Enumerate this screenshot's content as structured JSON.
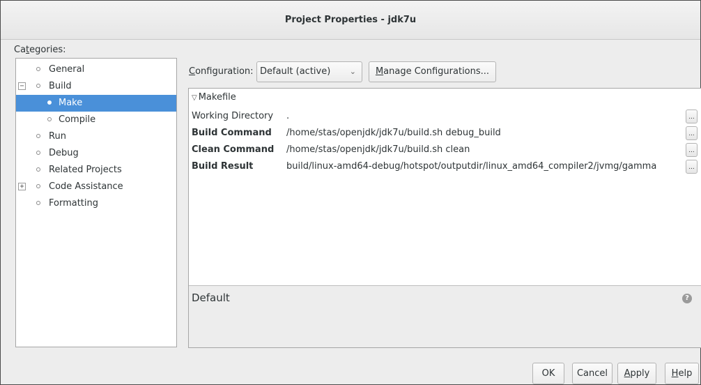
{
  "window": {
    "title": "Project Properties - jdk7u"
  },
  "categories": {
    "label_prefix": "Ca",
    "label_underline": "t",
    "label_suffix": "egories:",
    "items": [
      {
        "label": "General"
      },
      {
        "label": "Build",
        "expander": "−"
      },
      {
        "label": "Make",
        "selected": true
      },
      {
        "label": "Compile"
      },
      {
        "label": "Run"
      },
      {
        "label": "Debug"
      },
      {
        "label": "Related Projects"
      },
      {
        "label": "Code Assistance",
        "expander": "+"
      },
      {
        "label": "Formatting"
      }
    ]
  },
  "configuration": {
    "label_underline": "C",
    "label_rest": "onfiguration:",
    "selected_value": "Default (active)",
    "arrow": "⌄",
    "manage_underline": "M",
    "manage_rest": "anage Configurations..."
  },
  "makefile": {
    "section_label": "Makefile",
    "rows": [
      {
        "name": "Working Directory",
        "value": ".",
        "bold": false,
        "button": "..."
      },
      {
        "name": "Build Command",
        "value": "/home/stas/openjdk/jdk7u/build.sh debug_build",
        "bold": true,
        "button": "..."
      },
      {
        "name": "Clean Command",
        "value": "/home/stas/openjdk/jdk7u/build.sh clean",
        "bold": true,
        "button": "..."
      },
      {
        "name": "Build Result",
        "value": "build/linux-amd64-debug/hotspot/outputdir/linux_amd64_compiler2/jvmg/gamma",
        "bold": true,
        "button": "..."
      }
    ]
  },
  "description": {
    "title": "Default",
    "help_icon": "?"
  },
  "footer": {
    "ok": "OK",
    "cancel": "Cancel",
    "apply_underline": "A",
    "apply_rest": "pply",
    "help_underline": "H",
    "help_rest": "elp"
  }
}
